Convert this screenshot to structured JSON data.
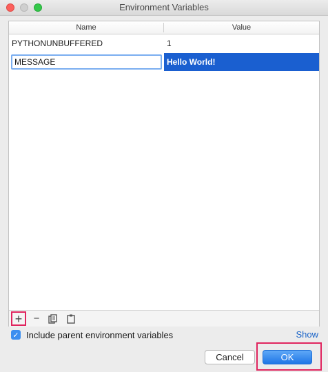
{
  "window": {
    "title": "Environment Variables",
    "controls": [
      "close",
      "minimize",
      "zoom"
    ]
  },
  "table": {
    "columns": [
      "Name",
      "Value"
    ],
    "rows": [
      {
        "name": "PYTHONUNBUFFERED",
        "value": "1"
      },
      {
        "name": "MESSAGE",
        "value": "Hello World!",
        "selected": true,
        "editing": true
      }
    ]
  },
  "toolbar": {
    "add_symbol": "+",
    "remove_symbol": "−",
    "icons": [
      "add-icon",
      "remove-icon",
      "copy-icon",
      "paste-icon"
    ]
  },
  "options": {
    "include_parent_label": "Include parent environment variables",
    "include_parent_checked": true,
    "show_link": "Show"
  },
  "buttons": {
    "cancel_label": "Cancel",
    "ok_label": "OK"
  },
  "colors": {
    "selection": "#1a5fd0",
    "highlight_outline": "#e0245e",
    "accent": "#3b8ef0"
  }
}
